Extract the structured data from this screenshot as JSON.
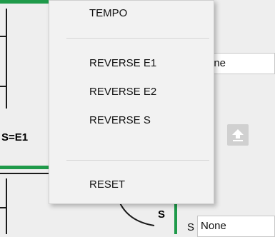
{
  "background": {
    "node_left_label": "S=E1",
    "node_bottom_label": "S",
    "field_top_value": "one",
    "field_bottom_prefix": "S",
    "field_bottom_value": "None"
  },
  "context_menu": {
    "items": [
      {
        "label": "TEMPO"
      },
      {
        "label": "REVERSE E1"
      },
      {
        "label": "REVERSE E2"
      },
      {
        "label": "REVERSE S"
      },
      {
        "label": "RESET"
      }
    ]
  },
  "icons": {
    "upload_button_icon": "upload-arrow-icon"
  },
  "colors": {
    "accent_green": "#1f9a4a",
    "menu_bg": "#f2f2f2",
    "disabled_button": "#d0d0d0"
  }
}
